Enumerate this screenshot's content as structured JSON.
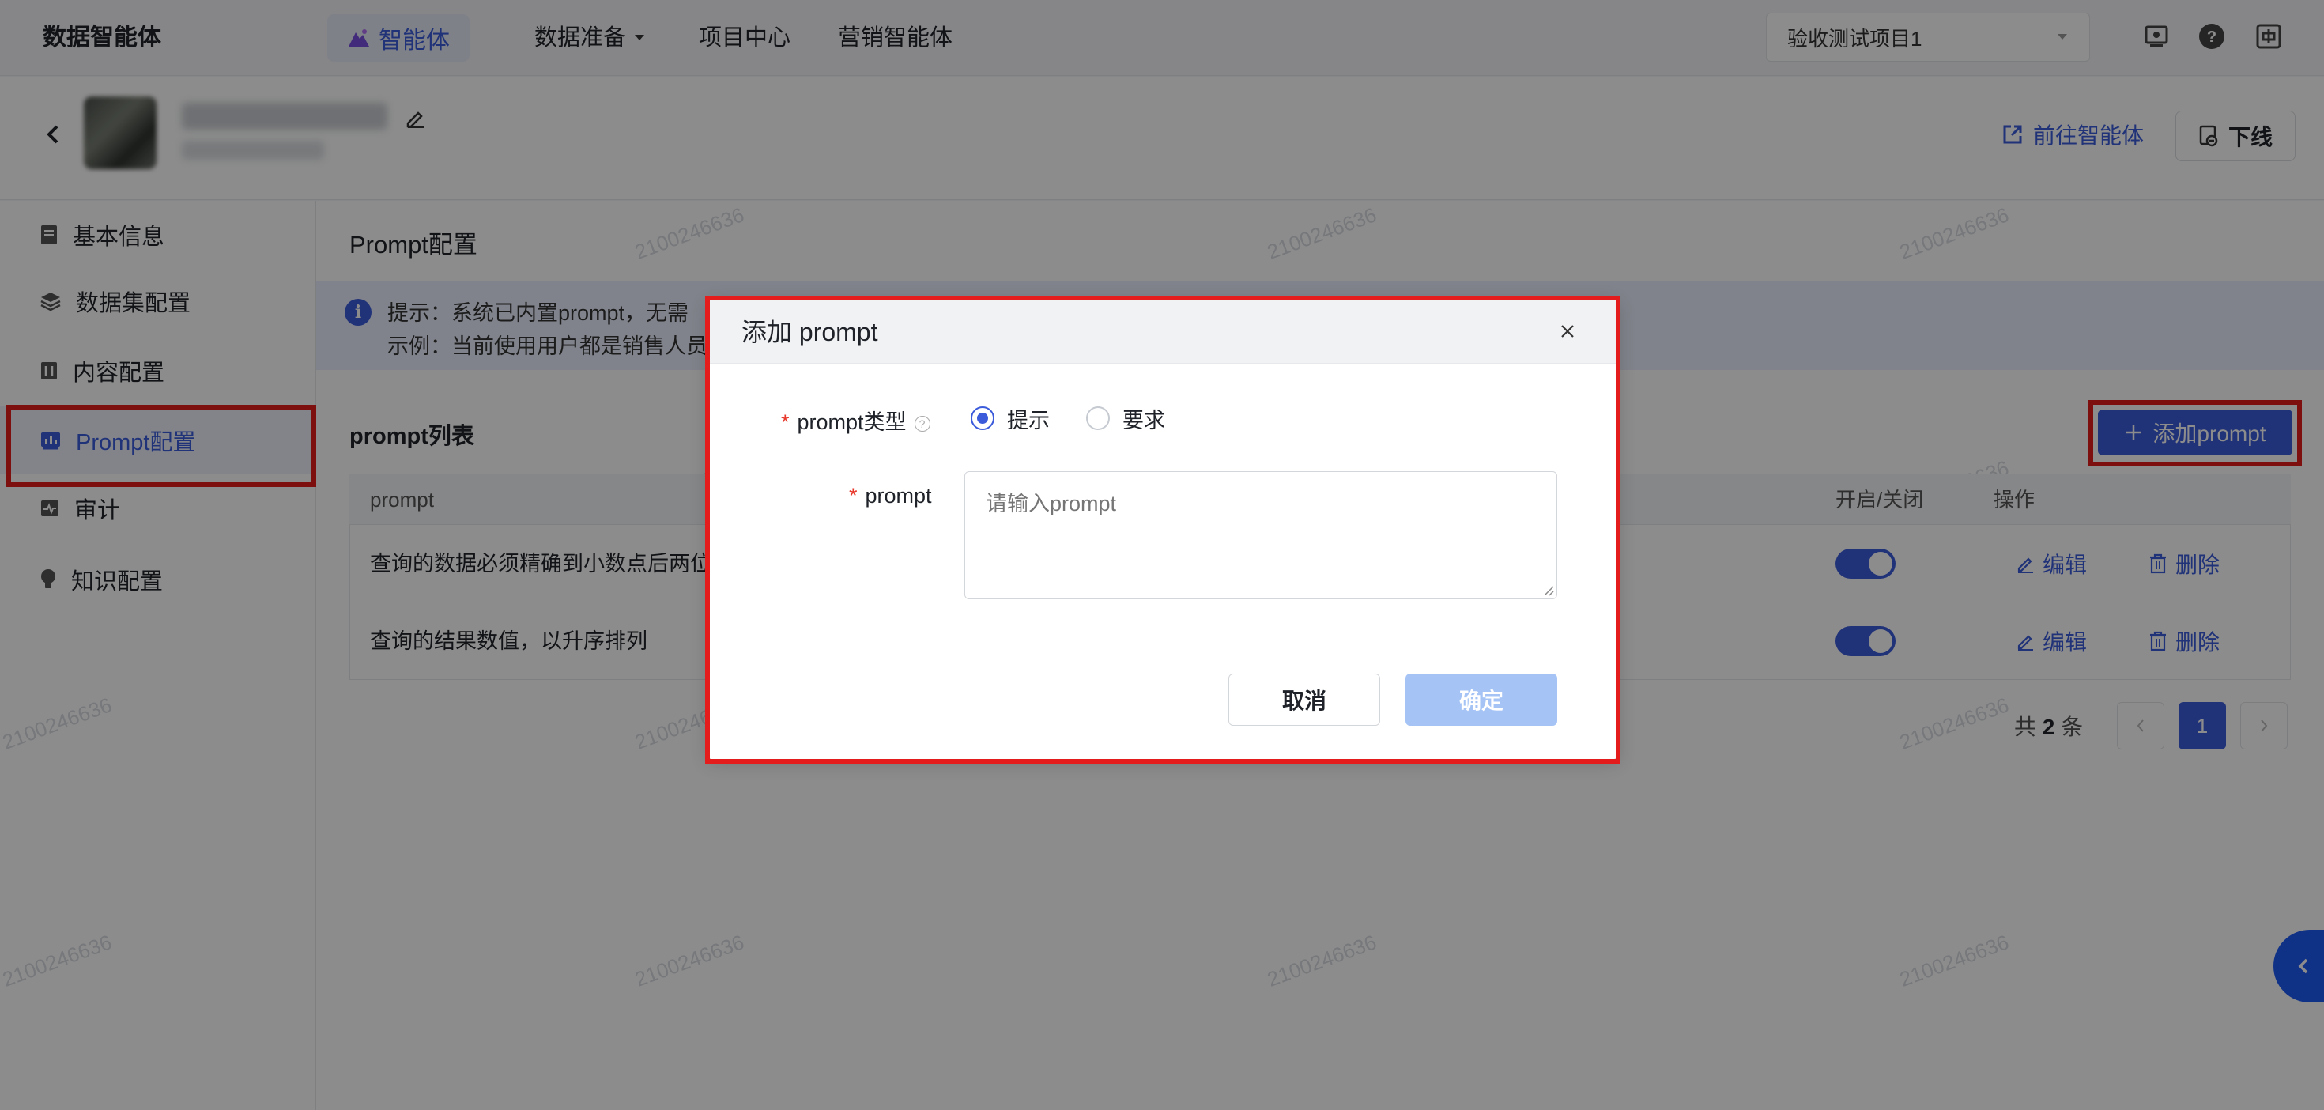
{
  "topbar": {
    "brand": "数据智能体",
    "nav": [
      {
        "label": "智能体",
        "active": true
      },
      {
        "label": "数据准备",
        "has_dropdown": true
      },
      {
        "label": "项目中心"
      },
      {
        "label": "营销智能体"
      }
    ],
    "project_select": {
      "value": "验收测试项目1"
    },
    "icons": [
      "screen-icon",
      "help-icon",
      "language-icon"
    ]
  },
  "header": {
    "go_to_agent": "前往智能体",
    "offline": "下线"
  },
  "sidebar": {
    "items": [
      {
        "label": "基本信息",
        "icon": "document-icon"
      },
      {
        "label": "数据集配置",
        "icon": "layers-icon"
      },
      {
        "label": "内容配置",
        "icon": "content-icon"
      },
      {
        "label": "Prompt配置",
        "icon": "chart-icon",
        "active": true
      },
      {
        "label": "审计",
        "icon": "audit-icon"
      },
      {
        "label": "知识配置",
        "icon": "bulb-icon"
      }
    ]
  },
  "main": {
    "section_title": "Prompt配置",
    "tip": {
      "line1": "提示：系统已内置prompt，无需",
      "line2": "示例：当前使用用户都是销售人员"
    },
    "list_title": "prompt列表",
    "add_button": "添加prompt",
    "table": {
      "columns": [
        "prompt",
        "开启/关闭",
        "操作"
      ],
      "rows": [
        {
          "prompt": "查询的数据必须精确到小数点后两位",
          "enabled": true
        },
        {
          "prompt": "查询的结果数值，以升序排列",
          "enabled": true
        }
      ],
      "edit_label": "编辑",
      "delete_label": "删除"
    },
    "pagination": {
      "total_prefix": "共",
      "total": "2",
      "total_suffix": "条",
      "current_page": "1"
    },
    "watermark": "2100246636"
  },
  "modal": {
    "title": "添加 prompt",
    "type_label": "prompt类型",
    "type_options": [
      {
        "label": "提示",
        "checked": true
      },
      {
        "label": "要求",
        "checked": false
      }
    ],
    "prompt_label": "prompt",
    "prompt_placeholder": "请输入prompt",
    "cancel": "取消",
    "confirm": "确定"
  },
  "colors": {
    "accent": "#3b5bdb",
    "highlight_border": "#e51c1c",
    "confirm_disabled": "#a5c4f5"
  }
}
